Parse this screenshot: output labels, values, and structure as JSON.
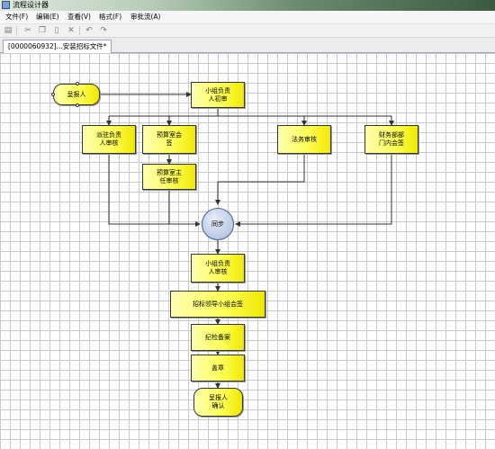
{
  "window": {
    "title": "流程设计器"
  },
  "menu": [
    "文件(F)",
    "编辑(E)",
    "查看(V)",
    "格式(F)",
    "审批流(A)"
  ],
  "toolbar": {
    "buttons": [
      {
        "icon": "save-icon"
      },
      {
        "icon": "cut-icon"
      },
      {
        "icon": "copy-icon"
      },
      {
        "icon": "paste-icon"
      },
      {
        "icon": "delete-icon"
      },
      {
        "icon": "undo-icon"
      },
      {
        "icon": "redo-icon"
      }
    ]
  },
  "tab": {
    "label": "[0000060932]...安装招标文件*"
  },
  "flow": {
    "start": "呈报人",
    "n1": "小组负责\n人初审",
    "b1": "派驻负责\n人审核",
    "b2": "预算室会\n签",
    "b2b": "预算室主\n任审核",
    "b3": "法务审核",
    "b4": "财务部部\n门内会签",
    "sync": "同步",
    "n2": "小组负责\n人审核",
    "n3": "招标领导小组会签",
    "n4": "纪检备案",
    "n5": "盖章",
    "end": "呈报人\n确认"
  },
  "colors": {
    "node_fill": "#ffff5a",
    "sync_fill": "#b8c8e6",
    "line": "#333333",
    "grid": "#c9c9c9"
  }
}
